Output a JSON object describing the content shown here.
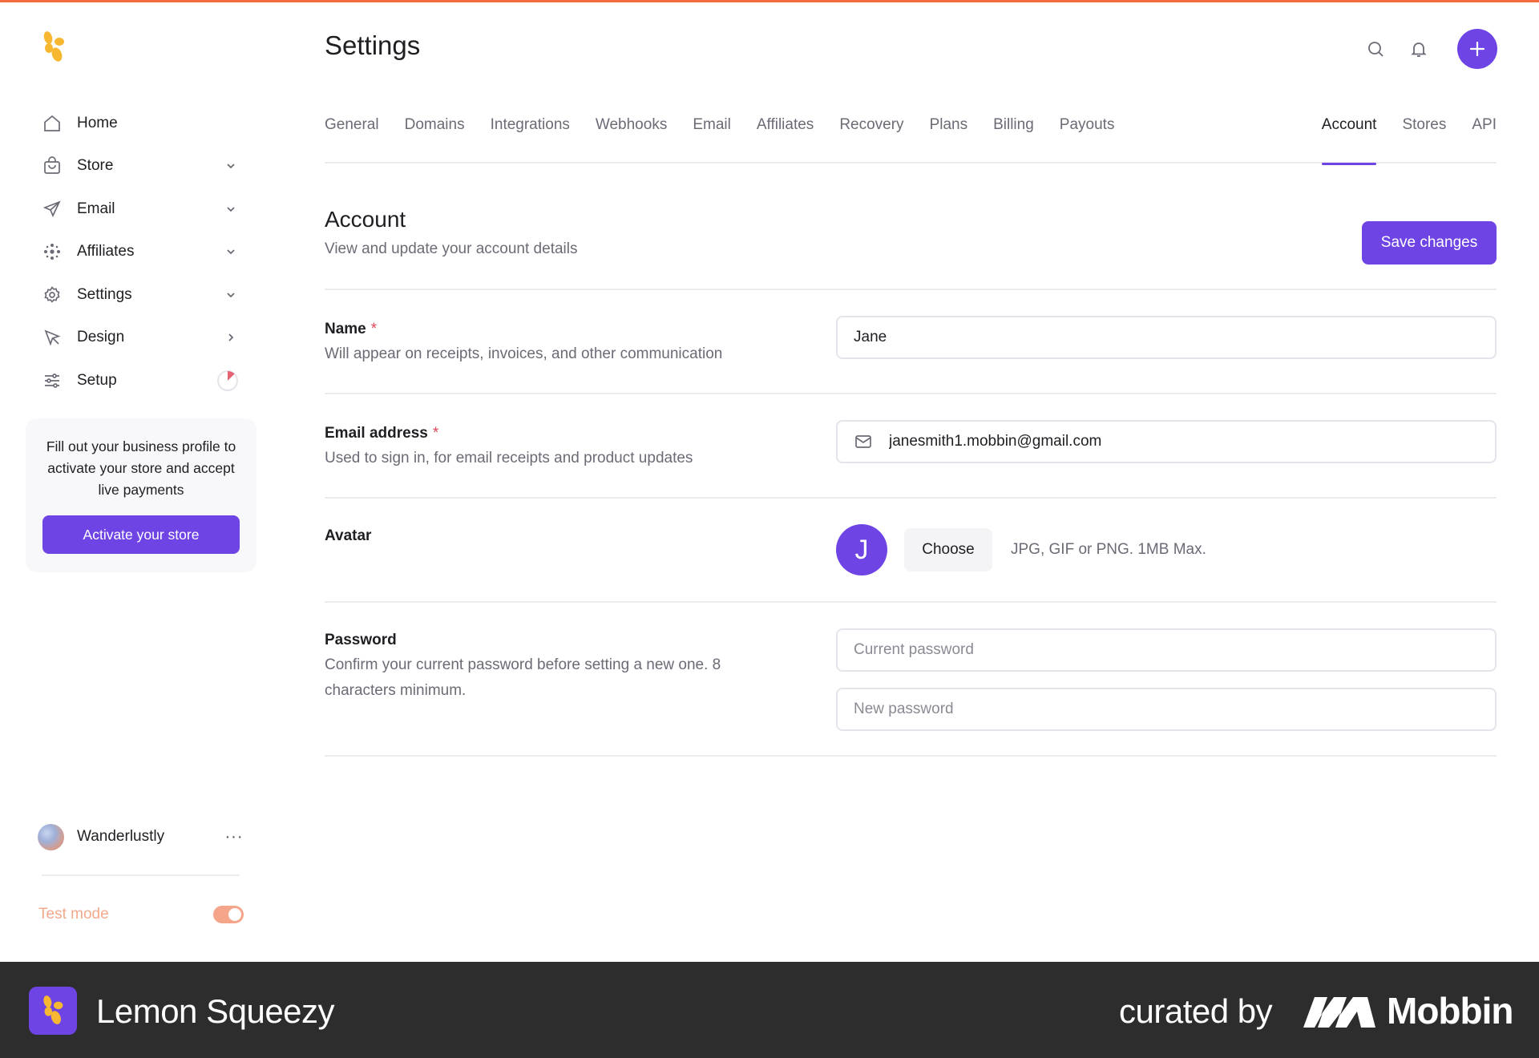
{
  "colors": {
    "accent": "#6e44e5",
    "top_bar": "#f26b3a",
    "required": "#e0465a",
    "test_mode": "#f3a98c"
  },
  "sidebar": {
    "logo_icon": "lemon-squeezy-logo-icon",
    "items": [
      {
        "label": "Home",
        "icon": "home-icon",
        "trail": ""
      },
      {
        "label": "Store",
        "icon": "shopping-bag-icon",
        "trail": "chevron-down"
      },
      {
        "label": "Email",
        "icon": "send-icon",
        "trail": "chevron-down"
      },
      {
        "label": "Affiliates",
        "icon": "network-icon",
        "trail": "chevron-down"
      },
      {
        "label": "Settings",
        "icon": "gear-icon",
        "trail": "chevron-down"
      },
      {
        "label": "Design",
        "icon": "cursor-icon",
        "trail": "chevron-right"
      },
      {
        "label": "Setup",
        "icon": "sliders-icon",
        "trail": "progress-ring"
      }
    ],
    "promo": {
      "text": "Fill out your business profile to activate your store and accept live payments",
      "button": "Activate your store"
    },
    "account": {
      "name": "Wanderlustly",
      "more": "···"
    },
    "test_mode": {
      "label": "Test mode",
      "enabled": true
    }
  },
  "header": {
    "title": "Settings",
    "icons": [
      "search-icon",
      "bell-icon",
      "plus-icon"
    ]
  },
  "tabs": {
    "left": [
      "General",
      "Domains",
      "Integrations",
      "Webhooks",
      "Email",
      "Affiliates",
      "Recovery",
      "Plans",
      "Billing",
      "Payouts"
    ],
    "right": [
      "Account",
      "Stores",
      "API"
    ],
    "active": "Account"
  },
  "section": {
    "title": "Account",
    "subtitle": "View and update your account details",
    "save_label": "Save changes"
  },
  "fields": {
    "name": {
      "label": "Name",
      "required": "*",
      "desc": "Will appear on receipts, invoices, and other communication",
      "value": "Jane"
    },
    "email": {
      "label": "Email address",
      "required": "*",
      "desc": "Used to sign in, for email receipts and product updates",
      "value": "janesmith1.mobbin@gmail.com"
    },
    "avatar": {
      "label": "Avatar",
      "initial": "J",
      "choose_label": "Choose",
      "hint": "JPG, GIF or PNG. 1MB Max."
    },
    "password": {
      "label": "Password",
      "desc": "Confirm your current password before setting a new one. 8 characters minimum.",
      "current_placeholder": "Current password",
      "new_placeholder": "New password"
    }
  },
  "footer": {
    "brand": "Lemon Squeezy",
    "curated": "curated by",
    "mobbin": "Mobbin"
  }
}
